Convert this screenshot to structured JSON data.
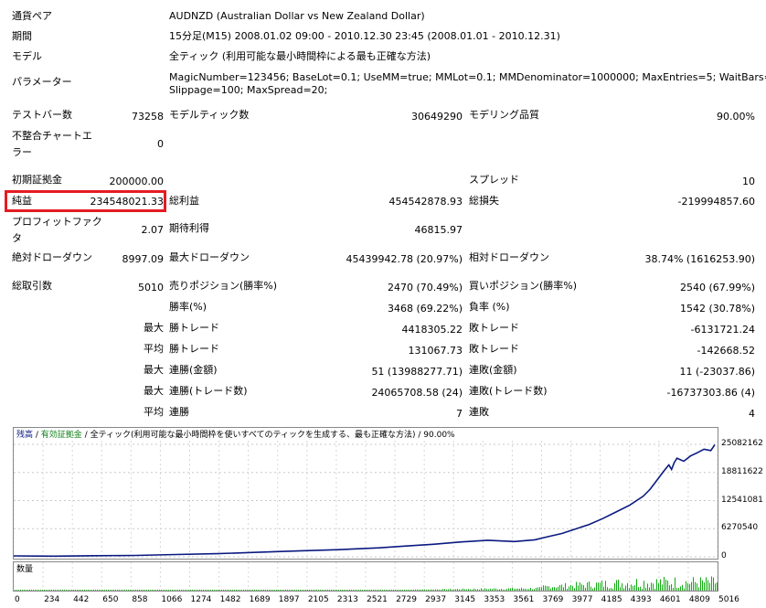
{
  "header": {
    "symbol_label": "通貨ペア",
    "symbol_value": "AUDNZD (Australian Dollar vs New Zealand Dollar)",
    "period_label": "期間",
    "period_value": "15分足(M15) 2008.01.02 09:00 - 2010.12.30 23:45 (2008.01.01 - 2010.12.31)",
    "model_label": "モデル",
    "model_value": "全ティック (利用可能な最小時間枠による最も正確な方法)",
    "params_label": "パラメーター",
    "params_line1": "MagicNumber=123456; BaseLot=0.1; UseMM=true; MMLot=0.1; MMDenominator=1000000; MaxEntries=5; WaitBars=2;",
    "params_line2": "Slippage=100; MaxSpread=20;"
  },
  "stats": {
    "bars_label": "テストバー数",
    "bars_value": "73258",
    "ticks_label": "モデルティック数",
    "ticks_value": "30649290",
    "quality_label": "モデリング品質",
    "quality_value": "90.00%",
    "mismatch_label": "不整合チャートエラー",
    "mismatch_value": "0",
    "deposit_label": "初期証拠金",
    "deposit_value": "200000.00",
    "spread_label": "スプレッド",
    "spread_value": "10",
    "net_label": "純益",
    "net_value": "234548021.33",
    "gross_profit_label": "総利益",
    "gross_profit_value": "454542878.93",
    "gross_loss_label": "総損失",
    "gross_loss_value": "-219994857.60",
    "pf_label": "プロフィットファクタ",
    "pf_value": "2.07",
    "exp_label": "期待利得",
    "exp_value": "46815.97",
    "abs_dd_label": "絶対ドローダウン",
    "abs_dd_value": "8997.09",
    "max_dd_label": "最大ドローダウン",
    "max_dd_value": "45439942.78 (20.97%)",
    "rel_dd_label": "相対ドローダウン",
    "rel_dd_value": "38.74% (1616253.90)",
    "trades_label": "総取引数",
    "trades_value": "5010",
    "short_label": "売りポジション(勝率%)",
    "short_value": "2470 (70.49%)",
    "long_label": "買いポジション(勝率%)",
    "long_value": "2540 (67.99%)",
    "win_rate_label": "勝率(%)",
    "win_rate_value": "3468 (69.22%)",
    "loss_rate_label": "負率 (%)",
    "loss_rate_value": "1542 (30.78%)",
    "max_label_1": "最大",
    "largest_win_label": "勝トレード",
    "largest_win_value": "4418305.22",
    "largest_loss_label": "敗トレード",
    "largest_loss_value": "-6131721.24",
    "avg_label": "平均",
    "avg_win_label": "勝トレード",
    "avg_win_value": "131067.73",
    "avg_loss_label": "敗トレード",
    "avg_loss_value": "-142668.52",
    "max_label_2": "最大",
    "cons_wins_label": "連勝(金額)",
    "cons_wins_value": "51 (13988277.71)",
    "cons_losses_label": "連敗(金額)",
    "cons_losses_value": "11 (-23037.86)",
    "max_label_3": "最大",
    "cons_wins_trades_label": "連勝(トレード数)",
    "cons_wins_trades_value": "24065708.58 (24)",
    "cons_losses_trades_label": "連敗(トレード数)",
    "cons_losses_trades_value": "-16737303.86 (4)",
    "avg_label_2": "平均",
    "avg_cons_wins_label": "連勝",
    "avg_cons_wins_value": "7",
    "avg_cons_losses_label": "連敗",
    "avg_cons_losses_value": "4"
  },
  "chart_legend": {
    "balance": "残高",
    "sep1": " / ",
    "equity": "有効証拠金",
    "sep2": " / ",
    "desc": "全ティック(利用可能な最小時間枠を使いすべてのティックを生成する、最も正確な方法)",
    "sep3": " / ",
    "quality": "90.00%",
    "volume_label": "数量"
  },
  "chart_data": {
    "type": "line",
    "y_ticks": [
      "25082162",
      "18811622",
      "12541081",
      "6270540",
      "0"
    ],
    "ylim": [
      0,
      25082162
    ],
    "x_ticks": [
      "0",
      "234",
      "442",
      "650",
      "858",
      "1066",
      "1274",
      "1482",
      "1689",
      "1897",
      "2105",
      "2313",
      "2521",
      "2729",
      "2937",
      "3145",
      "3353",
      "3561",
      "3769",
      "3977",
      "4185",
      "4393",
      "4601",
      "4809",
      "5016"
    ],
    "xlim": [
      0,
      5200
    ],
    "series": [
      {
        "x": [
          0,
          300,
          600,
          900,
          1200,
          1500,
          1800,
          2100,
          2400,
          2700,
          2900,
          3100,
          3300,
          3500,
          3700,
          3850,
          3950,
          4050,
          4150,
          4250,
          4350,
          4450,
          4550,
          4650,
          4700,
          4750,
          4800,
          4840,
          4860,
          4880,
          4900,
          4950,
          5000,
          5050,
          5100,
          5150,
          5180
        ],
        "y": [
          200000,
          150000,
          250000,
          300000,
          500000,
          700000,
          1000000,
          1300000,
          1600000,
          2000000,
          2400000,
          2800000,
          3300000,
          3700000,
          3400000,
          3800000,
          4500000,
          5200000,
          6200000,
          7200000,
          8500000,
          10000000,
          11500000,
          13500000,
          15000000,
          17000000,
          19000000,
          20500000,
          19500000,
          21000000,
          22000000,
          21300000,
          22500000,
          23200000,
          24000000,
          23700000,
          25000000
        ]
      }
    ]
  },
  "colors": {
    "balance": "#0a1a80",
    "volume": "#11aa11",
    "highlight": "#e41c22",
    "legend_green": "#11801a"
  }
}
